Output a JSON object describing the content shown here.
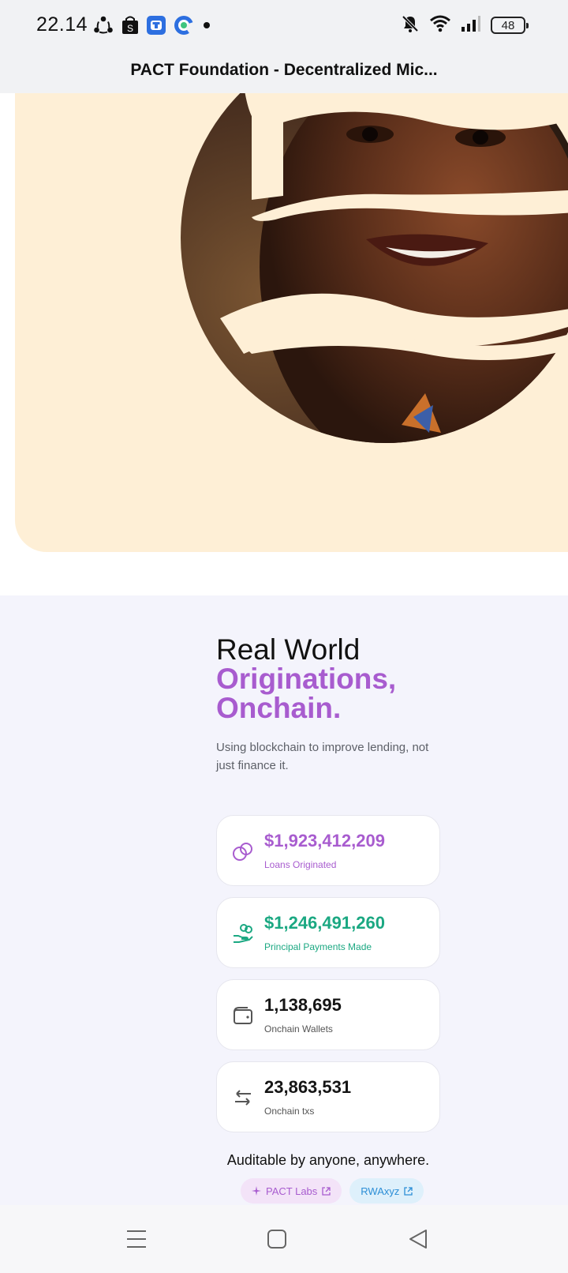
{
  "status_bar": {
    "time": "22.14",
    "battery": "48",
    "left_icons": [
      "share-icon",
      "shopee-bag-icon",
      "app-t-icon",
      "chrome-like-icon",
      "notification-dot"
    ],
    "right_icons": [
      "mute-icon",
      "wifi-icon",
      "signal-icon",
      "battery-icon"
    ]
  },
  "browser": {
    "page_title": "PACT Foundation - Decentralized Mic..."
  },
  "hero": {
    "background_color": "#feefd6",
    "image": "woman-portrait-wave-cutout"
  },
  "stats": {
    "headline_line1": "Real World",
    "headline_line2": "Originations,",
    "headline_line3": "Onchain.",
    "subtext": "Using blockchain to improve lending, not just finance it.",
    "cards": [
      {
        "value": "$1,923,412,209",
        "label": "Loans Originated",
        "icon": "coins-icon",
        "color": "#a85ccf"
      },
      {
        "value": "$1,246,491,260",
        "label": "Principal Payments Made",
        "icon": "hand-coins-icon",
        "color": "#1ba882"
      },
      {
        "value": "1,138,695",
        "label": "Onchain Wallets",
        "icon": "wallet-icon",
        "color": "#151515"
      },
      {
        "value": "23,863,531",
        "label": "Onchain txs",
        "icon": "arrows-exchange-icon",
        "color": "#151515"
      }
    ],
    "auditable_text": "Auditable by anyone, anywhere.",
    "links": [
      {
        "label": "PACT Labs",
        "icon": "sparkle-icon"
      },
      {
        "label": "RWAxyz",
        "icon": "external-link-icon"
      }
    ]
  },
  "nav_bar": {
    "buttons": [
      "menu-icon",
      "home-square-icon",
      "back-triangle-icon"
    ]
  },
  "colors": {
    "accent_purple": "#a85ccf",
    "accent_green": "#1ba882",
    "section_bg": "#f4f4fc"
  }
}
